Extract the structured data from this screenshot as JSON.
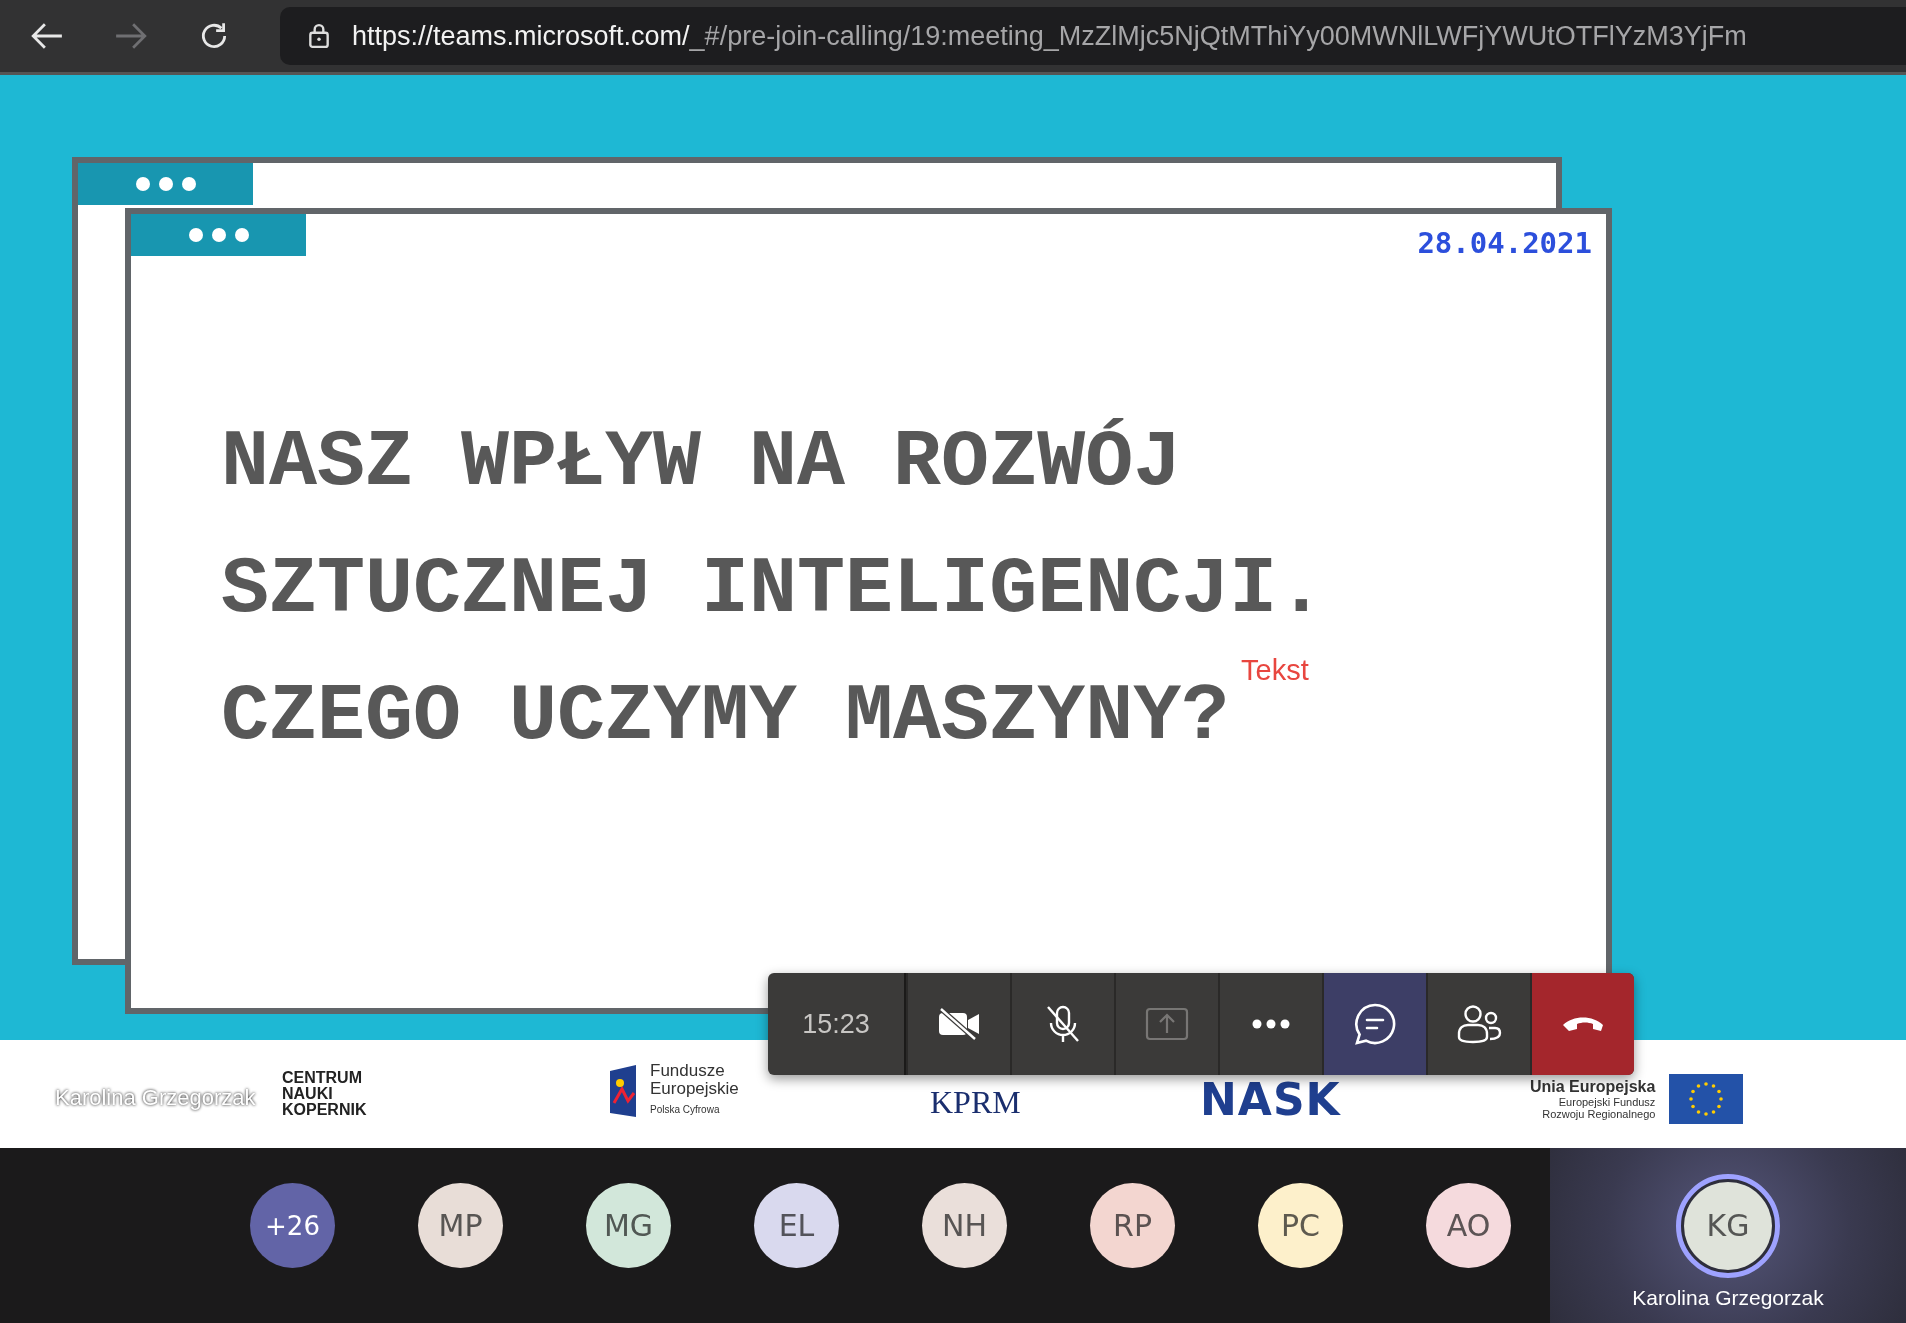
{
  "browser": {
    "back_enabled": true,
    "forward_enabled": false,
    "url_host": "https://teams.microsoft.com/",
    "url_path": "_#/pre-join-calling/19:meeting_MzZlMjc5NjQtMThiYy00MWNlLWFjYWUtOTFlYzM3YjFm"
  },
  "slide": {
    "date": "28.04.2021",
    "title_lines": [
      "NASZ WPŁYW NA ROZWÓJ",
      "SZTUCZNEJ INTELIGENCJI.",
      "CZEGO UCZYMY MASZYNY?"
    ],
    "annotation": "Tekst",
    "logos": [
      {
        "kind": "cnk",
        "lines": [
          "CENTRUM",
          "NAUKI",
          "KOPERNIK"
        ]
      },
      {
        "kind": "fe",
        "lines": [
          "Fundusze",
          "Europejskie",
          "Polska Cyfrowa"
        ]
      },
      {
        "kind": "kprm",
        "lines": [
          "KPRM"
        ]
      },
      {
        "kind": "nask",
        "lines": [
          "NASK"
        ]
      },
      {
        "kind": "eu",
        "lines": [
          "Unia Europejska",
          "Europejski Fundusz",
          "Rozwoju Regionalnego"
        ]
      }
    ]
  },
  "presenter_name": "Karolina Grzegorzak",
  "call_controls": {
    "time": "15:23",
    "buttons": [
      {
        "kind": "camera",
        "selected": false,
        "disabled": false
      },
      {
        "kind": "mic",
        "selected": false,
        "disabled": false
      },
      {
        "kind": "share",
        "selected": false,
        "disabled": true
      },
      {
        "kind": "more",
        "selected": false,
        "disabled": false
      },
      {
        "kind": "chat",
        "selected": true,
        "disabled": false
      },
      {
        "kind": "people",
        "selected": false,
        "disabled": false
      },
      {
        "kind": "hangup",
        "selected": false,
        "disabled": false
      }
    ]
  },
  "participants": [
    {
      "kind": "overflow",
      "initials": "+26",
      "color": "#6264a7"
    },
    {
      "kind": "person",
      "initials": "MP",
      "color": "#e8ddd7"
    },
    {
      "kind": "person",
      "initials": "MG",
      "color": "#d2e7da"
    },
    {
      "kind": "person",
      "initials": "EL",
      "color": "#d9d9ee"
    },
    {
      "kind": "person",
      "initials": "NH",
      "color": "#eadfda"
    },
    {
      "kind": "person",
      "initials": "RP",
      "color": "#f3d6d0"
    },
    {
      "kind": "person",
      "initials": "PC",
      "color": "#fdf0cb"
    },
    {
      "kind": "person",
      "initials": "AO",
      "color": "#f5dadd"
    }
  ],
  "self": {
    "initials": "KG",
    "color": "#dfe3da",
    "name": "Karolina Grzegorzak"
  }
}
